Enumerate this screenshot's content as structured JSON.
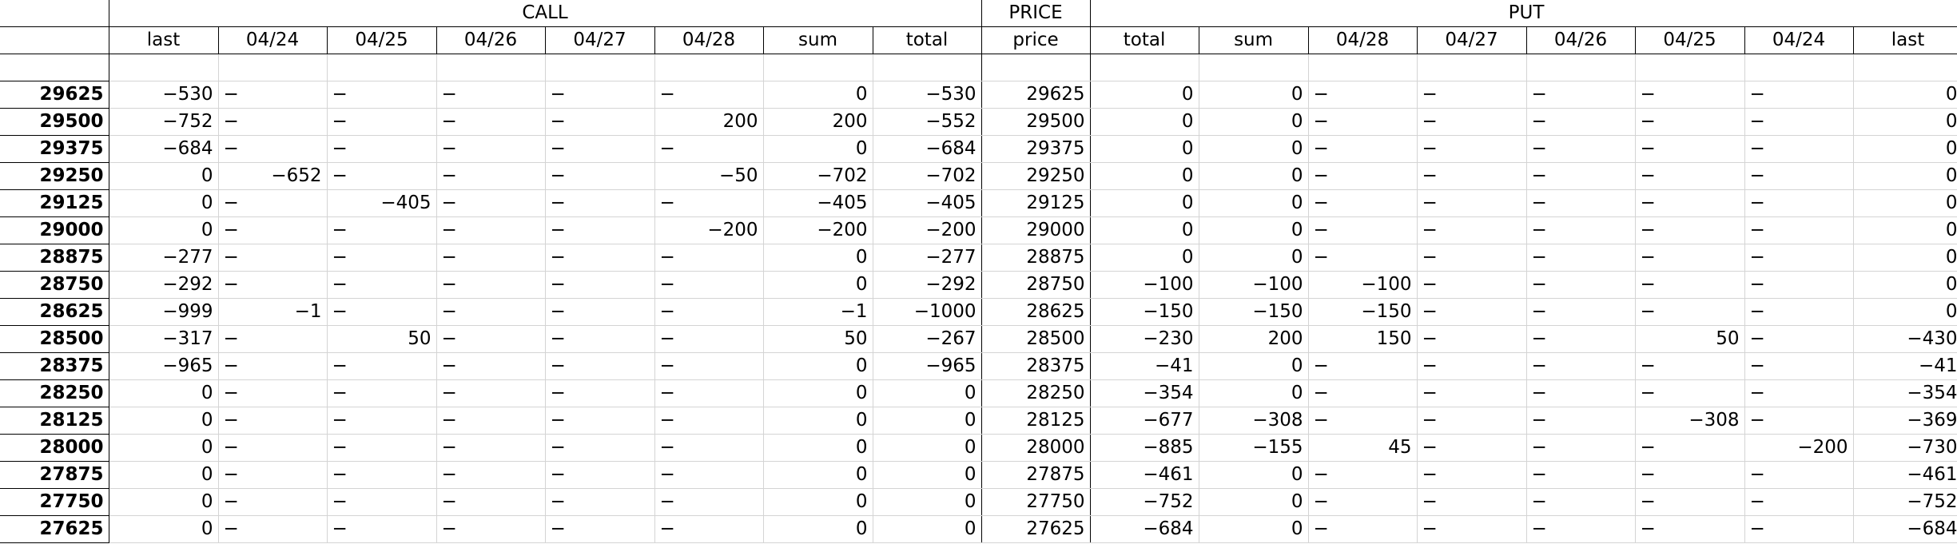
{
  "groups": {
    "call": "CALL",
    "price": "PRICE",
    "put": "PUT"
  },
  "columns": [
    "last",
    "04/24",
    "04/25",
    "04/26",
    "04/27",
    "04/28",
    "sum",
    "total",
    "price",
    "total",
    "sum",
    "04/28",
    "04/27",
    "04/26",
    "04/25",
    "04/24",
    "last"
  ],
  "rows": [
    {
      "label": "29625",
      "cells": [
        "−530",
        "−",
        "−",
        "−",
        "−",
        "−",
        "0",
        "−530",
        "29625",
        "0",
        "0",
        "−",
        "−",
        "−",
        "−",
        "−",
        "0"
      ]
    },
    {
      "label": "29500",
      "cells": [
        "−752",
        "−",
        "−",
        "−",
        "−",
        "200",
        "200",
        "−552",
        "29500",
        "0",
        "0",
        "−",
        "−",
        "−",
        "−",
        "−",
        "0"
      ]
    },
    {
      "label": "29375",
      "cells": [
        "−684",
        "−",
        "−",
        "−",
        "−",
        "−",
        "0",
        "−684",
        "29375",
        "0",
        "0",
        "−",
        "−",
        "−",
        "−",
        "−",
        "0"
      ]
    },
    {
      "label": "29250",
      "cells": [
        "0",
        "−652",
        "−",
        "−",
        "−",
        "−50",
        "−702",
        "−702",
        "29250",
        "0",
        "0",
        "−",
        "−",
        "−",
        "−",
        "−",
        "0"
      ]
    },
    {
      "label": "29125",
      "cells": [
        "0",
        "−",
        "−405",
        "−",
        "−",
        "−",
        "−405",
        "−405",
        "29125",
        "0",
        "0",
        "−",
        "−",
        "−",
        "−",
        "−",
        "0"
      ]
    },
    {
      "label": "29000",
      "cells": [
        "0",
        "−",
        "−",
        "−",
        "−",
        "−200",
        "−200",
        "−200",
        "29000",
        "0",
        "0",
        "−",
        "−",
        "−",
        "−",
        "−",
        "0"
      ]
    },
    {
      "label": "28875",
      "cells": [
        "−277",
        "−",
        "−",
        "−",
        "−",
        "−",
        "0",
        "−277",
        "28875",
        "0",
        "0",
        "−",
        "−",
        "−",
        "−",
        "−",
        "0"
      ]
    },
    {
      "label": "28750",
      "cells": [
        "−292",
        "−",
        "−",
        "−",
        "−",
        "−",
        "0",
        "−292",
        "28750",
        "−100",
        "−100",
        "−100",
        "−",
        "−",
        "−",
        "−",
        "0"
      ]
    },
    {
      "label": "28625",
      "cells": [
        "−999",
        "−1",
        "−",
        "−",
        "−",
        "−",
        "−1",
        "−1000",
        "28625",
        "−150",
        "−150",
        "−150",
        "−",
        "−",
        "−",
        "−",
        "0"
      ]
    },
    {
      "label": "28500",
      "cells": [
        "−317",
        "−",
        "50",
        "−",
        "−",
        "−",
        "50",
        "−267",
        "28500",
        "−230",
        "200",
        "150",
        "−",
        "−",
        "50",
        "−",
        "−430"
      ]
    },
    {
      "label": "28375",
      "cells": [
        "−965",
        "−",
        "−",
        "−",
        "−",
        "−",
        "0",
        "−965",
        "28375",
        "−41",
        "0",
        "−",
        "−",
        "−",
        "−",
        "−",
        "−41"
      ]
    },
    {
      "label": "28250",
      "cells": [
        "0",
        "−",
        "−",
        "−",
        "−",
        "−",
        "0",
        "0",
        "28250",
        "−354",
        "0",
        "−",
        "−",
        "−",
        "−",
        "−",
        "−354"
      ]
    },
    {
      "label": "28125",
      "cells": [
        "0",
        "−",
        "−",
        "−",
        "−",
        "−",
        "0",
        "0",
        "28125",
        "−677",
        "−308",
        "−",
        "−",
        "−",
        "−308",
        "−",
        "−369"
      ]
    },
    {
      "label": "28000",
      "cells": [
        "0",
        "−",
        "−",
        "−",
        "−",
        "−",
        "0",
        "0",
        "28000",
        "−885",
        "−155",
        "45",
        "−",
        "−",
        "−",
        "−200",
        "−730"
      ]
    },
    {
      "label": "27875",
      "cells": [
        "0",
        "−",
        "−",
        "−",
        "−",
        "−",
        "0",
        "0",
        "27875",
        "−461",
        "0",
        "−",
        "−",
        "−",
        "−",
        "−",
        "−461"
      ]
    },
    {
      "label": "27750",
      "cells": [
        "0",
        "−",
        "−",
        "−",
        "−",
        "−",
        "0",
        "0",
        "27750",
        "−752",
        "0",
        "−",
        "−",
        "−",
        "−",
        "−",
        "−752"
      ]
    },
    {
      "label": "27625",
      "cells": [
        "0",
        "−",
        "−",
        "−",
        "−",
        "−",
        "0",
        "0",
        "27625",
        "−684",
        "0",
        "−",
        "−",
        "−",
        "−",
        "−",
        "−684"
      ]
    }
  ]
}
